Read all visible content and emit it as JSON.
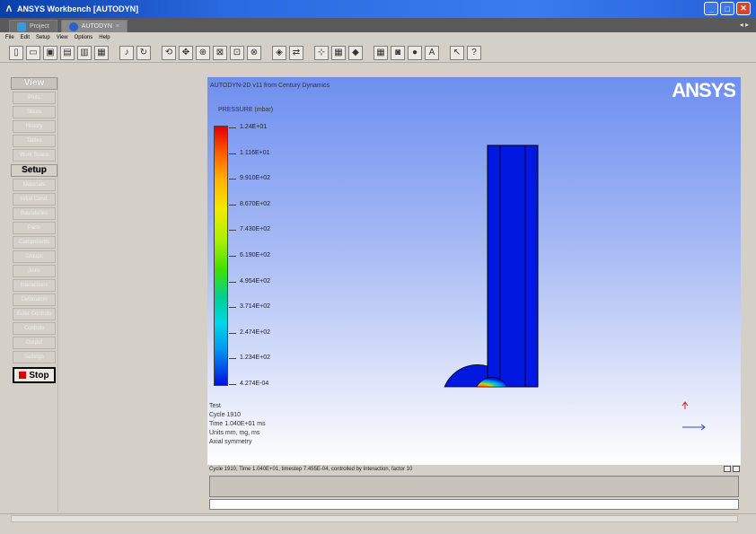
{
  "window": {
    "title": "ANSYS Workbench [AUTODYN]",
    "colors": {
      "title_bar": "#2a6ae0",
      "viewport_top": "#6e8ff0",
      "stop": "#e00000"
    }
  },
  "tabs": [
    {
      "label": "Project",
      "active": false
    },
    {
      "label": "AUTODYN",
      "active": true
    }
  ],
  "menu": [
    "File",
    "Edit",
    "Setup",
    "View",
    "Options",
    "Help"
  ],
  "nav": {
    "view_header": "View",
    "view_items": [
      "Plots",
      "Slices",
      "History",
      "Tables",
      "Work Space"
    ],
    "setup_header": "Setup",
    "setup_items": [
      "Materials",
      "Initial Cond.",
      "Boundaries",
      "Parts",
      "Components",
      "Groups",
      "Joins",
      "Interactions",
      "Detonation",
      "Euler Controls",
      "Controls",
      "Output",
      "Settings"
    ],
    "stop_label": "Stop"
  },
  "viewport": {
    "header": "AUTODYN-2D v11 from Century Dynamics",
    "logo": "ANSYS",
    "legend_title": "PRESSURE (mbar)",
    "legend_values": [
      "1.24E+01",
      "1.116E+01",
      "9.910E+02",
      "8.670E+02",
      "7.430E+02",
      "6.190E+02",
      "4.954E+02",
      "3.714E+02",
      "2.474E+02",
      "1.234E+02",
      "4.274E-04"
    ],
    "info_lines": [
      "Test",
      "Cycle 1910",
      "Time 1.040E+01 ms",
      "Units mm, mg, ms",
      "Axial symmetry"
    ]
  },
  "status": {
    "line": "Cycle 1910, Time 1.040E+01, timestep 7.455E-04, controlled by Interaction, factor 10"
  },
  "toolbar_icons": [
    "new-icon",
    "open-icon",
    "save-icon",
    "save-as-icon",
    "copy-icon",
    "print-icon",
    "sep",
    "run-icon",
    "refresh-icon",
    "sep",
    "rotate-icon",
    "pan-icon",
    "zoom-icon",
    "zoom-box-icon",
    "fit-icon",
    "reset-icon",
    "sep",
    "view3d-icon",
    "flip-icon",
    "sep",
    "axes-icon",
    "color-icon",
    "render-icon",
    "sep",
    "grid-icon",
    "camera-icon",
    "record-icon",
    "text-icon",
    "sep",
    "pointer-icon",
    "help-icon"
  ]
}
